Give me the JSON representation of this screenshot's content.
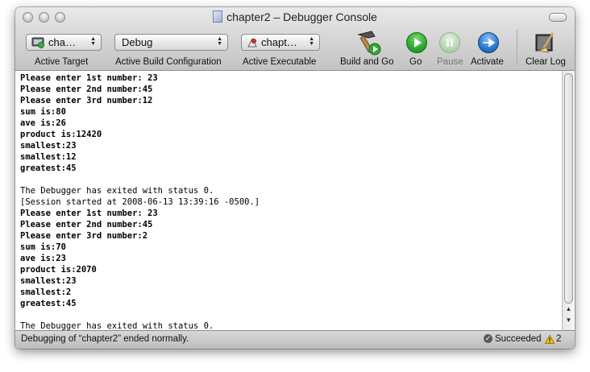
{
  "window": {
    "title": "chapter2 – Debugger Console"
  },
  "toolbar": {
    "active_target": {
      "value": "cha…",
      "label": "Active Target"
    },
    "build_config": {
      "value": "Debug",
      "label": "Active Build Configuration"
    },
    "active_executable": {
      "value": "chapt…",
      "label": "Active Executable"
    },
    "build_and_go": {
      "label": "Build and Go",
      "icon": "hammer-icon"
    },
    "go": {
      "label": "Go",
      "icon": "play-icon"
    },
    "pause": {
      "label": "Pause",
      "icon": "pause-icon"
    },
    "activate": {
      "label": "Activate",
      "icon": "debugger-activate-icon"
    },
    "clear_log": {
      "label": "Clear Log",
      "icon": "broom-icon"
    }
  },
  "console": {
    "lines": [
      {
        "text": "Please enter 1st number: 23",
        "bold": true
      },
      {
        "text": "Please enter 2nd number:45",
        "bold": true
      },
      {
        "text": "Please enter 3rd number:12",
        "bold": true
      },
      {
        "text": "sum is:80",
        "bold": true
      },
      {
        "text": "ave is:26",
        "bold": true
      },
      {
        "text": "product is:12420",
        "bold": true
      },
      {
        "text": "smallest:23",
        "bold": true
      },
      {
        "text": "smallest:12",
        "bold": true
      },
      {
        "text": "greatest:45",
        "bold": true
      },
      {
        "text": "",
        "bold": false
      },
      {
        "text": "The Debugger has exited with status 0.",
        "bold": false
      },
      {
        "text": "[Session started at 2008-06-13 13:39:16 -0500.]",
        "bold": false
      },
      {
        "text": "Please enter 1st number: 23",
        "bold": true
      },
      {
        "text": "Please enter 2nd number:45",
        "bold": true
      },
      {
        "text": "Please enter 3rd number:2",
        "bold": true
      },
      {
        "text": "sum is:70",
        "bold": true
      },
      {
        "text": "ave is:23",
        "bold": true
      },
      {
        "text": "product is:2070",
        "bold": true
      },
      {
        "text": "smallest:23",
        "bold": true
      },
      {
        "text": "smallest:2",
        "bold": true
      },
      {
        "text": "greatest:45",
        "bold": true
      },
      {
        "text": "",
        "bold": false
      },
      {
        "text": "The Debugger has exited with status 0.",
        "bold": false
      }
    ]
  },
  "status_bar": {
    "message": "Debugging of “chapter2” ended normally.",
    "result": "Succeeded",
    "warnings": "2"
  },
  "colors": {
    "go_green": "#2fa82f",
    "activate_blue": "#2b78d0",
    "pause_disabled": "#b9d7b2",
    "warning_yellow": "#f0c419"
  }
}
